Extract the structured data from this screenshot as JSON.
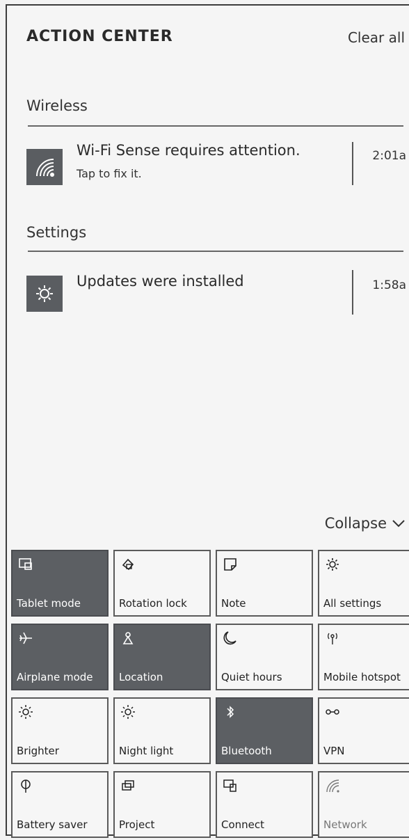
{
  "header": {
    "title": "ACTION CENTER",
    "clear_all": "Clear all"
  },
  "groups": [
    {
      "title": "Wireless",
      "notification": {
        "icon": "wifi-sense-icon",
        "title": "Wi-Fi Sense requires attention.",
        "subtitle": "Tap to fix it.",
        "time": "2:01a"
      }
    },
    {
      "title": "Settings",
      "notification": {
        "icon": "gear-icon",
        "title": "Updates were installed",
        "subtitle": "",
        "time": "1:58a"
      }
    }
  ],
  "collapse_label": "Collapse",
  "quick_actions": [
    {
      "label": "Tablet mode",
      "icon": "tablet-mode-icon",
      "on": true
    },
    {
      "label": "Rotation lock",
      "icon": "rotation-lock-icon",
      "on": false
    },
    {
      "label": "Note",
      "icon": "note-icon",
      "on": false
    },
    {
      "label": "All settings",
      "icon": "gear-icon",
      "on": false
    },
    {
      "label": "Airplane mode",
      "icon": "airplane-icon",
      "on": true
    },
    {
      "label": "Location",
      "icon": "location-icon",
      "on": true
    },
    {
      "label": "Quiet hours",
      "icon": "moon-icon",
      "on": false
    },
    {
      "label": "Mobile hotspot",
      "icon": "hotspot-icon",
      "on": false
    },
    {
      "label": "Brighter",
      "icon": "brightness-icon",
      "on": false
    },
    {
      "label": "Night light",
      "icon": "night-light-icon",
      "on": false
    },
    {
      "label": "Bluetooth",
      "icon": "bluetooth-icon",
      "on": true
    },
    {
      "label": "VPN",
      "icon": "vpn-icon",
      "on": false
    },
    {
      "label": "Battery saver",
      "icon": "battery-saver-icon",
      "on": false
    },
    {
      "label": "Project",
      "icon": "project-icon",
      "on": false
    },
    {
      "label": "Connect",
      "icon": "connect-icon",
      "on": false
    },
    {
      "label": "Network",
      "icon": "network-icon",
      "on": false
    }
  ],
  "colors": {
    "tile_on": "#5c5f63",
    "background": "#f5f5f5",
    "text": "#222222"
  }
}
